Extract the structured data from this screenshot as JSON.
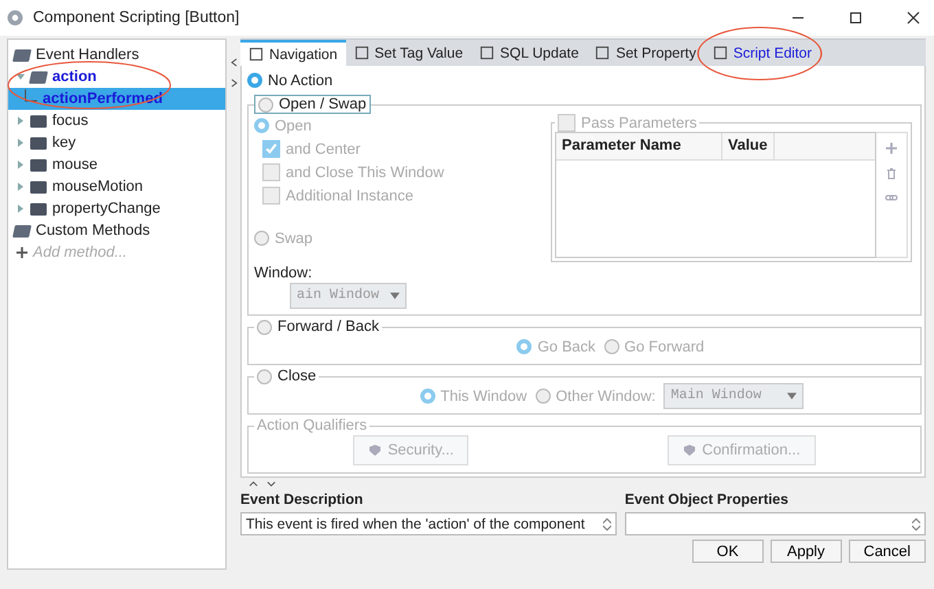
{
  "window": {
    "title": "Component Scripting [Button]"
  },
  "tree": [
    {
      "label": "Event Handlers",
      "expanded": true,
      "selected": false,
      "highlighted": false,
      "children": [
        {
          "label": "action",
          "expanded": true,
          "selected": false,
          "highlighted": true,
          "children": [
            {
              "label": "actionPerformed",
              "selected": true,
              "highlighted": true
            }
          ]
        },
        {
          "label": "focus",
          "expanded": false,
          "selected": false,
          "highlighted": false
        },
        {
          "label": "key",
          "expanded": false,
          "selected": false,
          "highlighted": false
        },
        {
          "label": "mouse",
          "expanded": false,
          "selected": false,
          "highlighted": false
        },
        {
          "label": "mouseMotion",
          "expanded": false,
          "selected": false,
          "highlighted": false
        },
        {
          "label": "propertyChange",
          "expanded": false,
          "selected": false,
          "highlighted": false
        }
      ]
    },
    {
      "label": "Custom Methods",
      "expanded": true,
      "selected": false,
      "highlighted": false,
      "add_placeholder": "Add method..."
    }
  ],
  "tabs": [
    {
      "label": "Navigation",
      "selected": true,
      "configured": false
    },
    {
      "label": "Set Tag Value",
      "selected": false,
      "configured": false
    },
    {
      "label": "SQL Update",
      "selected": false,
      "configured": false
    },
    {
      "label": "Set Property",
      "selected": false,
      "configured": false
    },
    {
      "label": "Script Editor",
      "selected": false,
      "configured": true
    }
  ],
  "navigation": {
    "no_action": {
      "label": "No Action",
      "selected": true
    },
    "open_swap": {
      "label": "Open / Swap",
      "selected": false,
      "open": {
        "label": "Open",
        "selected": true
      },
      "options": [
        {
          "label": "and Center",
          "checked": true
        },
        {
          "label": "and Close This Window",
          "checked": false
        },
        {
          "label": "Additional Instance",
          "checked": false
        }
      ],
      "swap": {
        "label": "Swap",
        "selected": false
      },
      "pass_parameters": {
        "label": "Pass Parameters",
        "checked": false
      },
      "parameter_columns": [
        "Parameter Name",
        "Value"
      ],
      "window_label": "Window:",
      "window_value": "ain Window"
    },
    "forward_back": {
      "label": "Forward / Back",
      "selected": false,
      "options": [
        {
          "label": "Go Back",
          "selected": true
        },
        {
          "label": "Go Forward",
          "selected": false
        }
      ]
    },
    "close": {
      "label": "Close",
      "selected": false,
      "options": [
        {
          "label": "This Window",
          "selected": true
        },
        {
          "label": "Other Window:",
          "selected": false
        }
      ],
      "window_value": "Main Window"
    },
    "qualifiers": {
      "label": "Action Qualifiers",
      "buttons": [
        "Security...",
        "Confirmation..."
      ]
    }
  },
  "event_description": {
    "label": "Event Description",
    "value": "This event is fired when the 'action' of the component"
  },
  "event_properties": {
    "label": "Event Object Properties"
  },
  "buttons": [
    "OK",
    "Apply",
    "Cancel"
  ]
}
